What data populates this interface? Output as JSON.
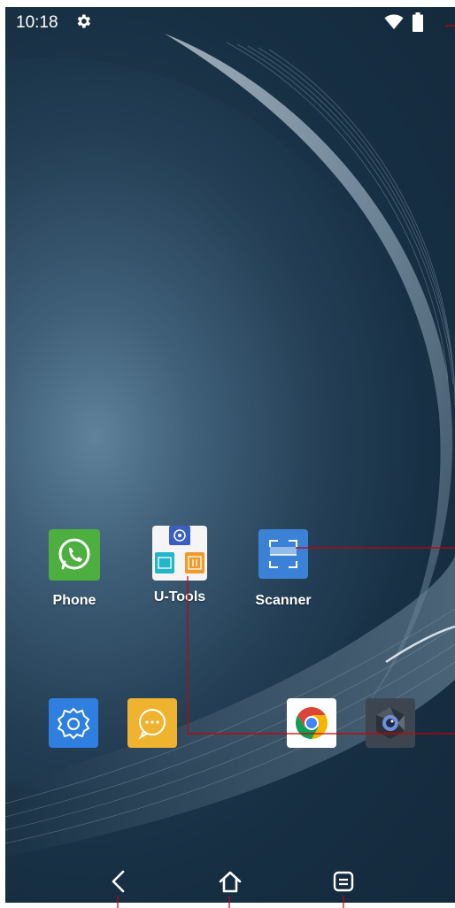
{
  "status_bar": {
    "time": "10:18",
    "icons": [
      "settings-gear-icon",
      "wifi-icon",
      "battery-icon"
    ]
  },
  "home_row_1": [
    {
      "label": "Phone",
      "icon": "phone-icon",
      "color": "#4caf3f"
    },
    {
      "label": "U-Tools",
      "icon": "u-tools-folder-icon",
      "color": "#f5f5f5"
    },
    {
      "label": "Scanner",
      "icon": "scanner-icon",
      "color": "#3b82d6"
    }
  ],
  "dock": [
    {
      "icon": "settings-icon",
      "color": "#2f7fe0"
    },
    {
      "icon": "messages-icon",
      "color": "#f0b330"
    },
    {
      "icon": "chrome-icon",
      "color": "#ffffff"
    },
    {
      "icon": "camera-icon",
      "color": "#3d4650"
    }
  ],
  "nav_bar": {
    "icons": [
      "back-icon",
      "home-icon",
      "recents-icon"
    ]
  },
  "colors": {
    "annotation_line": "#cc0000",
    "label_text": "#ffffff"
  }
}
